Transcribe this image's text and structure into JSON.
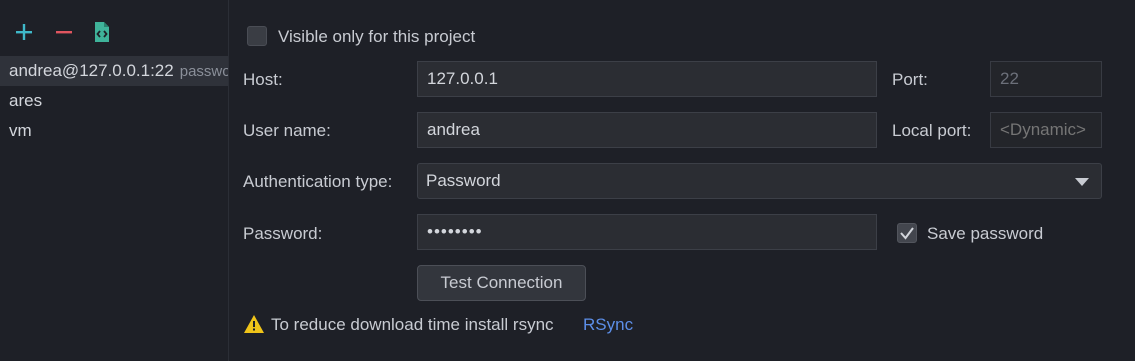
{
  "connections": [
    {
      "name": "andrea@127.0.0.1:22",
      "sub": "password",
      "selected": true
    },
    {
      "name": "ares",
      "sub": "",
      "selected": false
    },
    {
      "name": "vm",
      "sub": "",
      "selected": false
    }
  ],
  "toolbar": {
    "add_icon": "plus-icon",
    "remove_icon": "minus-icon",
    "copy_icon": "copy-config-icon"
  },
  "form": {
    "visible_only_label": "Visible only for this project",
    "visible_only_checked": false,
    "host_label": "Host:",
    "host_value": "127.0.0.1",
    "port_label": "Port:",
    "port_value": "22",
    "username_label": "User name:",
    "username_value": "andrea",
    "local_port_label": "Local port:",
    "local_port_placeholder": "<Dynamic>",
    "auth_type_label": "Authentication type:",
    "auth_type_value": "Password",
    "password_label": "Password:",
    "password_value": "••••••••",
    "save_password_label": "Save password",
    "save_password_checked": true,
    "test_connection_label": "Test Connection"
  },
  "warning": {
    "icon": "warning-icon",
    "text": "To reduce download time install rsync",
    "link": "RSync"
  },
  "colors": {
    "background": "#1e2027",
    "add": "#3fb8c9",
    "remove": "#e0555f",
    "copy": "#3fb39a",
    "warning": "#f0c419",
    "link": "#5c8ee8"
  }
}
